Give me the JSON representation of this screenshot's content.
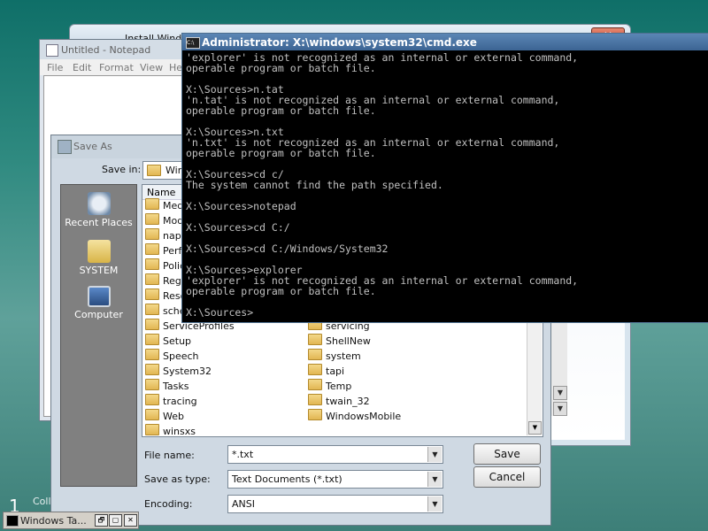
{
  "install_window": {
    "title": "Install Wind",
    "close": "✕"
  },
  "notepad": {
    "title": "Untitled - Notepad",
    "menu": [
      "File",
      "Edit",
      "Format",
      "View",
      "He"
    ]
  },
  "save_as": {
    "title": "Save As",
    "save_in_label": "Save in:",
    "save_in_value": "Win",
    "places": [
      {
        "label": "Recent Places",
        "icon": "recent-places-icon"
      },
      {
        "label": "SYSTEM",
        "icon": "user-folder-icon"
      },
      {
        "label": "Computer",
        "icon": "computer-icon"
      }
    ],
    "column_header": "Name",
    "files_col1": [
      "Medi",
      "Mode",
      "nap",
      "Perfo",
      "Polic",
      "Regi",
      "Reso",
      "sche",
      "ServiceProfiles",
      "Setup",
      "Speech",
      "System32",
      "Tasks",
      "tracing",
      "Web",
      "winsxs"
    ],
    "files_col2": [
      "servicing",
      "ShellNew",
      "system",
      "tapi",
      "Temp",
      "twain_32",
      "WindowsMobile"
    ],
    "file_name_label": "File name:",
    "file_name_value": "*.txt",
    "save_type_label": "Save as type:",
    "save_type_value": "Text Documents (*.txt)",
    "encoding_label": "Encoding:",
    "encoding_value": "ANSI",
    "save_button": "Save",
    "cancel_button": "Cancel"
  },
  "cmd": {
    "title": "Administrator: X:\\windows\\system32\\cmd.exe",
    "icon_text": "C:\\",
    "lines": [
      "'explorer' is not recognized as an internal or external command,",
      "operable program or batch file.",
      "",
      "X:\\Sources>n.tat",
      "'n.tat' is not recognized as an internal or external command,",
      "operable program or batch file.",
      "",
      "X:\\Sources>n.txt",
      "'n.txt' is not recognized as an internal or external command,",
      "operable program or batch file.",
      "",
      "X:\\Sources>cd c/",
      "The system cannot find the path specified.",
      "",
      "X:\\Sources>notepad",
      "",
      "X:\\Sources>cd C:/",
      "",
      "X:\\Sources>cd C:/Windows/System32",
      "",
      "X:\\Sources>explorer",
      "'explorer' is not recognized as an internal or external command,",
      "operable program or batch file.",
      "",
      "X:\\Sources>"
    ]
  },
  "taskbar": {
    "window_button": "Windows Ta...",
    "controls": [
      "🗗",
      "▢",
      "✕"
    ],
    "bg_text_digit": "1",
    "bg_text": "Coll"
  }
}
